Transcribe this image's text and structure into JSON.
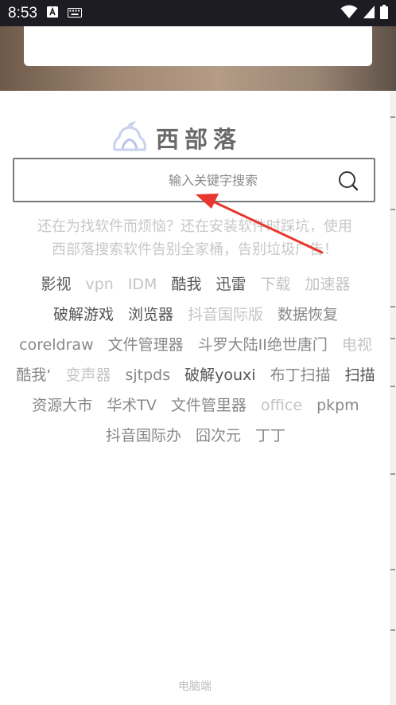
{
  "status_bar": {
    "time": "8:53",
    "icons": [
      "text-a-icon",
      "keyboard-icon",
      "wifi-icon",
      "signal-icon",
      "battery-icon"
    ]
  },
  "logo": {
    "text": "西部落",
    "icon": "cloud-logo-icon"
  },
  "search": {
    "placeholder": "输入关键字搜索",
    "icon": "search-icon"
  },
  "tagline": [
    "还在为找软件而烦恼？还在安装软件时踩坑，使用",
    "西部落搜索软件告别全家桶，告别垃圾广告！"
  ],
  "tags": [
    {
      "label": "影视",
      "tone": "dark"
    },
    {
      "label": "vpn",
      "tone": "light"
    },
    {
      "label": "IDM",
      "tone": "light"
    },
    {
      "label": "酷我",
      "tone": "dark"
    },
    {
      "label": "迅雷",
      "tone": "dark"
    },
    {
      "label": "下载",
      "tone": "light"
    },
    {
      "label": "加速器",
      "tone": "light"
    },
    {
      "label": "破解游戏",
      "tone": "dark"
    },
    {
      "label": "浏览器",
      "tone": "dark"
    },
    {
      "label": "抖音国际版",
      "tone": "light"
    },
    {
      "label": "数据恢复",
      "tone": "mid"
    },
    {
      "label": "coreldraw",
      "tone": "mid"
    },
    {
      "label": "文件管理器",
      "tone": "mid"
    },
    {
      "label": "斗罗大陆II绝世唐门",
      "tone": "mid"
    },
    {
      "label": "电视",
      "tone": "light"
    },
    {
      "label": "酷我‘",
      "tone": "mid"
    },
    {
      "label": "变声器",
      "tone": "light"
    },
    {
      "label": "sjtpds",
      "tone": "mid"
    },
    {
      "label": "破解youxi",
      "tone": "dark"
    },
    {
      "label": "布丁扫描",
      "tone": "mid"
    },
    {
      "label": "扫描",
      "tone": "dark"
    },
    {
      "label": "资源大市",
      "tone": "mid"
    },
    {
      "label": "华术TV",
      "tone": "mid"
    },
    {
      "label": "文件管里器",
      "tone": "mid"
    },
    {
      "label": "office",
      "tone": "light"
    },
    {
      "label": "pkpm",
      "tone": "mid"
    },
    {
      "label": "抖音国际办",
      "tone": "mid"
    },
    {
      "label": "囧次元",
      "tone": "mid"
    },
    {
      "label": "丁丁",
      "tone": "mid"
    }
  ],
  "footer": {
    "label": "电脑端"
  },
  "colors": {
    "annotation_arrow": "#e8372f"
  }
}
